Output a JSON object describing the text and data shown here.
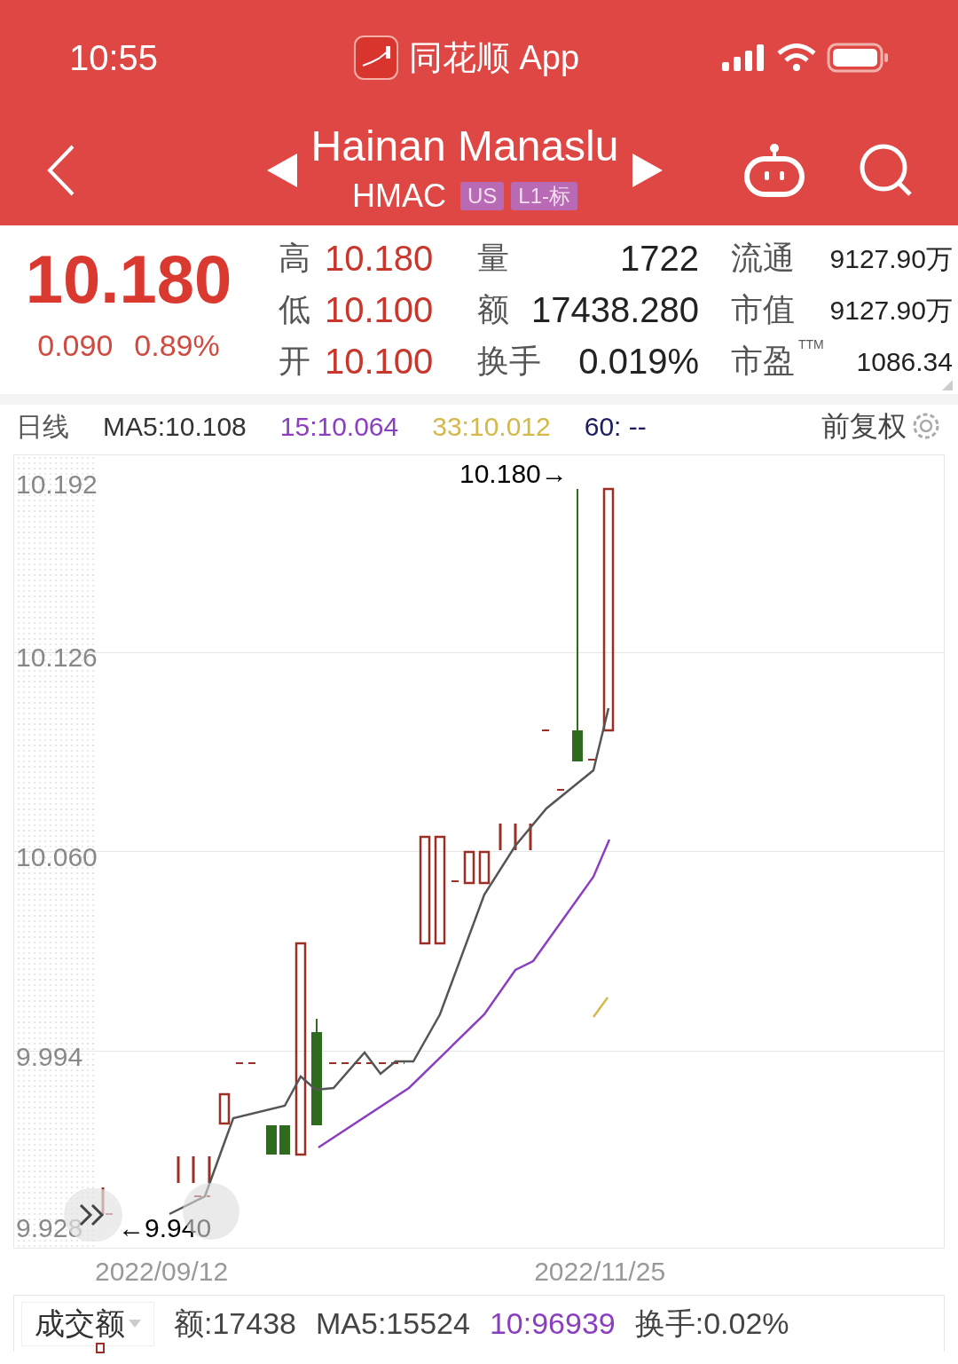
{
  "status_bar": {
    "time": "10:55",
    "app_name": "同花顺 App"
  },
  "header": {
    "title": "Hainan Manaslu",
    "symbol": "HMAC",
    "tags": [
      "US",
      "L1-标"
    ]
  },
  "quote": {
    "price": "10.180",
    "change": "0.090",
    "change_pct": "0.89%"
  },
  "price_stats": [
    {
      "label": "高",
      "value": "10.180"
    },
    {
      "label": "低",
      "value": "10.100"
    },
    {
      "label": "开",
      "value": "10.100"
    }
  ],
  "volume_stats": [
    {
      "label": "量",
      "value": "1722"
    },
    {
      "label": "额",
      "value": "17438.280"
    },
    {
      "label": "换手",
      "value": "0.019%"
    }
  ],
  "market_stats": [
    {
      "label": "流通",
      "value": "9127.90万"
    },
    {
      "label": "市值",
      "value": "9127.90万"
    },
    {
      "label": "市盈",
      "note": "TTM",
      "value": "1086.34"
    }
  ],
  "chart": {
    "period": "日线",
    "averages": [
      {
        "text": "MA5:10.108",
        "color": "#333333"
      },
      {
        "text": "15:10.064",
        "color": "#8b3fc0"
      },
      {
        "text": "33:10.012",
        "color": "#d4b84a"
      },
      {
        "text": "60: --",
        "color": "#1c1c5e"
      }
    ],
    "adjust": "前复权",
    "y_labels": [
      "10.192",
      "10.126",
      "10.060",
      "9.994",
      "9.928"
    ],
    "high_label": "10.180→",
    "low_label": "←9.940",
    "dates": [
      "2022/09/12",
      "2022/11/25"
    ]
  },
  "volume_bar": {
    "selector": "成交额",
    "items": [
      {
        "text": "额:17438",
        "color": "#444444"
      },
      {
        "text": "MA5:15524",
        "color": "#444444"
      },
      {
        "text": "10:96939",
        "color": "#8b3fc0"
      },
      {
        "text": "换手:0.02%",
        "color": "#444444"
      }
    ]
  }
}
